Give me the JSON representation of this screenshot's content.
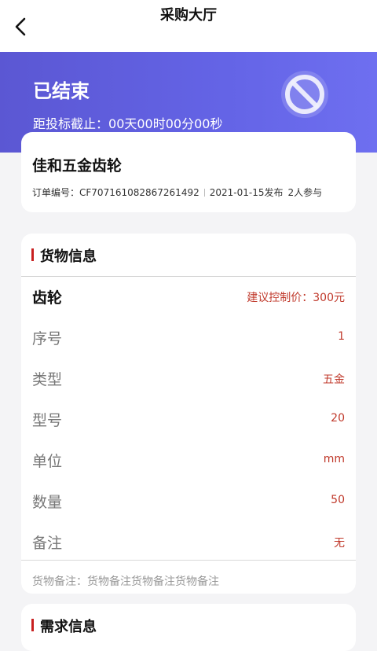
{
  "nav": {
    "title": "采购大厅",
    "back_icon": "chevron-left-icon"
  },
  "status": {
    "title": "已结束",
    "deadline_label": "距投标截止：",
    "deadline_value": "00天00时00分00秒",
    "icon": "prohibited-icon"
  },
  "order": {
    "product_name": "佳和五金齿轮",
    "order_no_label": "订单编号：",
    "order_no": "CF707161082867261492",
    "published": "2021-01-15发布",
    "participants": "2人参与"
  },
  "goods": {
    "section_title": "货物信息",
    "item_name": "齿轮",
    "suggested_price": "建议控制价：300元",
    "rows": [
      {
        "label": "序号",
        "value": "1"
      },
      {
        "label": "类型",
        "value": "五金"
      },
      {
        "label": "型号",
        "value": "20"
      },
      {
        "label": "单位",
        "value": "mm"
      },
      {
        "label": "数量",
        "value": "50"
      },
      {
        "label": "备注",
        "value": "无"
      }
    ],
    "remark": "货物备注：货物备注货物备注货物备注"
  },
  "demand": {
    "section_title": "需求信息"
  },
  "colors": {
    "banner": "#5b57d3",
    "accent_red": "#c0392b",
    "section_bar": "#c81f1f"
  }
}
